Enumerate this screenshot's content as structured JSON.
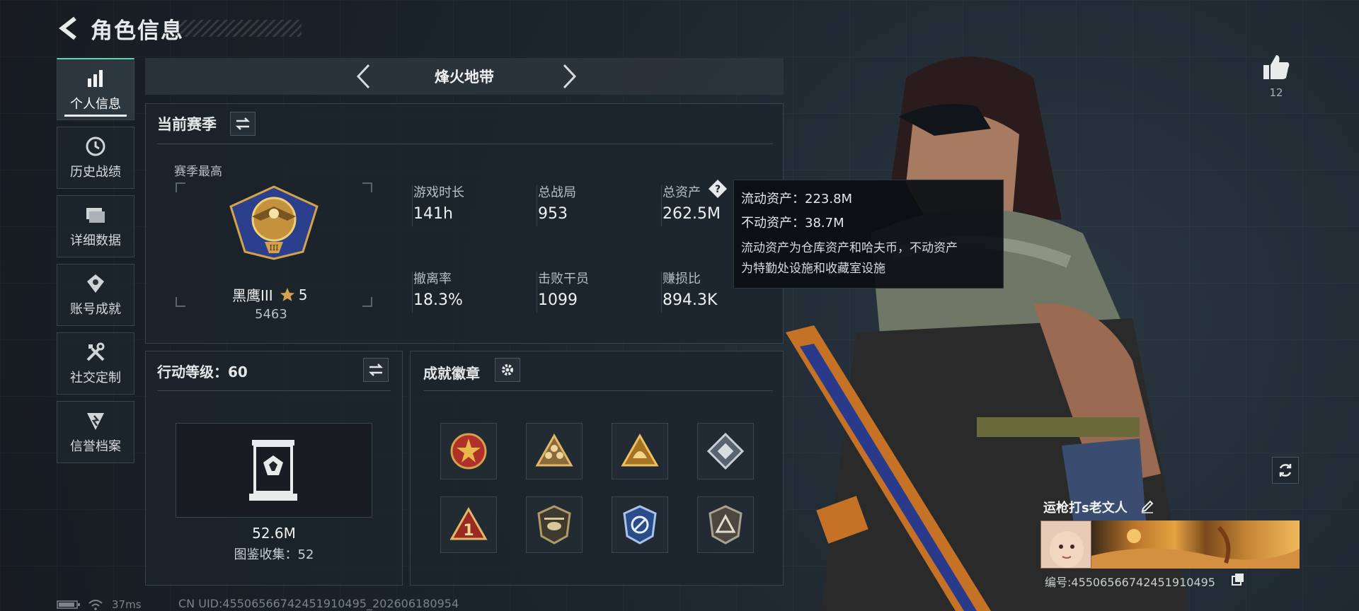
{
  "header": {
    "title": "角色信息"
  },
  "sidebar": {
    "items": [
      {
        "label": "个人信息",
        "icon": "bar-chart-icon",
        "active": true
      },
      {
        "label": "历史战绩",
        "icon": "history-clock-icon",
        "active": false
      },
      {
        "label": "详细数据",
        "icon": "folder-icon",
        "active": false
      },
      {
        "label": "账号成就",
        "icon": "achievement-icon",
        "active": false
      },
      {
        "label": "社交定制",
        "icon": "tools-icon",
        "active": false
      },
      {
        "label": "信誉档案",
        "icon": "reputation-icon",
        "active": false
      }
    ]
  },
  "tabbar": {
    "title": "烽火地带"
  },
  "season": {
    "title": "当前赛季",
    "best_label": "赛季最高",
    "rank_name": "黑鹰III",
    "rank_stars": "5",
    "rank_score": "5463",
    "stats": [
      {
        "label": "游戏时长",
        "value": "141h"
      },
      {
        "label": "总战局",
        "value": "953"
      },
      {
        "label": "总资产",
        "value": "262.5M"
      },
      {
        "label": "撤离率",
        "value": "18.3%"
      },
      {
        "label": "击败干员",
        "value": "1099"
      },
      {
        "label": "赚损比",
        "value": "894.3K"
      }
    ]
  },
  "tooltip": {
    "liquid": "流动资产：223.8M",
    "fixed": "不动资产：38.7M",
    "desc_line1": "流动资产为仓库资产和哈夫币，不动资产",
    "desc_line2": "为特勤处设施和收藏室设施"
  },
  "action_level": {
    "title": "行动等级：60",
    "value": "52.6M",
    "collection": "图鉴收集：52"
  },
  "badges": {
    "title": "成就徽章",
    "items": [
      "star-emblem-badge",
      "team-triangle-badge",
      "helmet-triangle-badge",
      "diamond-shield-badge",
      "number-one-badge",
      "helicopter-badge",
      "compass-shield-badge",
      "triangle-shield-badge"
    ]
  },
  "profile": {
    "likes": "12",
    "name": "运枪打s老文人",
    "id": "编号:455065667424519104​95"
  },
  "status": {
    "ping": "37ms",
    "uid": "CN UID:4550656674245191049​5_202606180954"
  },
  "colors": {
    "accent": "#5fd3b4",
    "background": "#1a2229",
    "gold": "#d4a24a"
  }
}
